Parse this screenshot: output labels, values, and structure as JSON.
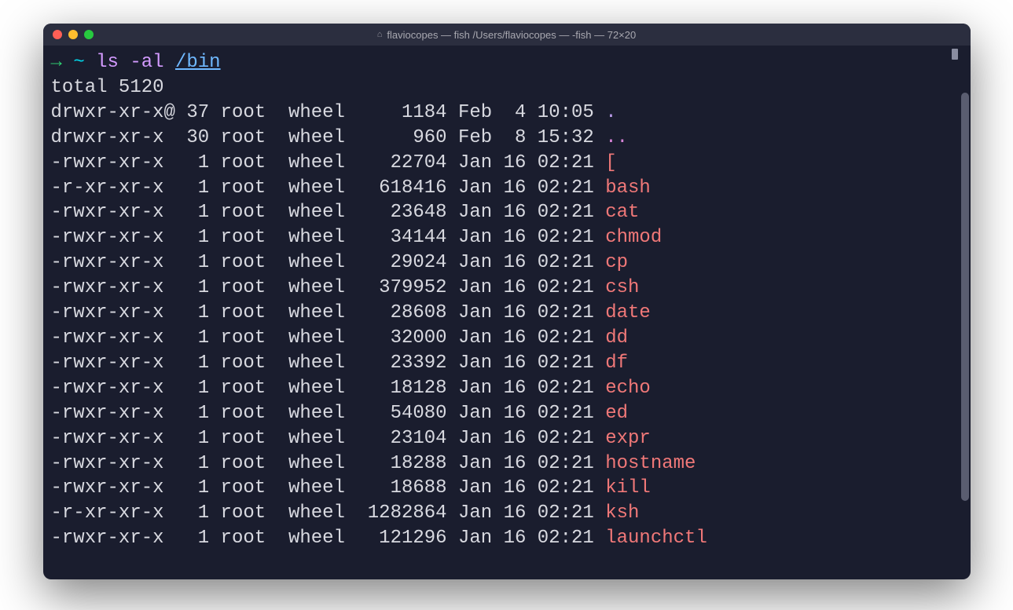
{
  "window": {
    "title": "flaviocopes — fish  /Users/flaviocopes — -fish — 72×20"
  },
  "prompt": {
    "arrow": "→",
    "tilde": "~",
    "cmd": "ls",
    "flags": "-al",
    "path": "/bin"
  },
  "total_line": "total 5120",
  "rows": [
    {
      "perms": "drwxr-xr-x@",
      "links": "37",
      "owner": "root",
      "group": "wheel",
      "size": "1184",
      "month": "Feb",
      "day": "4",
      "time": "10:05",
      "name": ".",
      "nameClass": "fname-dot"
    },
    {
      "perms": "drwxr-xr-x ",
      "links": "30",
      "owner": "root",
      "group": "wheel",
      "size": "960",
      "month": "Feb",
      "day": "8",
      "time": "15:32",
      "name": "..",
      "nameClass": "fname-ddot"
    },
    {
      "perms": "-rwxr-xr-x ",
      "links": "1",
      "owner": "root",
      "group": "wheel",
      "size": "22704",
      "month": "Jan",
      "day": "16",
      "time": "02:21",
      "name": "[",
      "nameClass": "fname-exec"
    },
    {
      "perms": "-r-xr-xr-x ",
      "links": "1",
      "owner": "root",
      "group": "wheel",
      "size": "618416",
      "month": "Jan",
      "day": "16",
      "time": "02:21",
      "name": "bash",
      "nameClass": "fname-exec"
    },
    {
      "perms": "-rwxr-xr-x ",
      "links": "1",
      "owner": "root",
      "group": "wheel",
      "size": "23648",
      "month": "Jan",
      "day": "16",
      "time": "02:21",
      "name": "cat",
      "nameClass": "fname-exec"
    },
    {
      "perms": "-rwxr-xr-x ",
      "links": "1",
      "owner": "root",
      "group": "wheel",
      "size": "34144",
      "month": "Jan",
      "day": "16",
      "time": "02:21",
      "name": "chmod",
      "nameClass": "fname-exec"
    },
    {
      "perms": "-rwxr-xr-x ",
      "links": "1",
      "owner": "root",
      "group": "wheel",
      "size": "29024",
      "month": "Jan",
      "day": "16",
      "time": "02:21",
      "name": "cp",
      "nameClass": "fname-exec"
    },
    {
      "perms": "-rwxr-xr-x ",
      "links": "1",
      "owner": "root",
      "group": "wheel",
      "size": "379952",
      "month": "Jan",
      "day": "16",
      "time": "02:21",
      "name": "csh",
      "nameClass": "fname-exec"
    },
    {
      "perms": "-rwxr-xr-x ",
      "links": "1",
      "owner": "root",
      "group": "wheel",
      "size": "28608",
      "month": "Jan",
      "day": "16",
      "time": "02:21",
      "name": "date",
      "nameClass": "fname-exec"
    },
    {
      "perms": "-rwxr-xr-x ",
      "links": "1",
      "owner": "root",
      "group": "wheel",
      "size": "32000",
      "month": "Jan",
      "day": "16",
      "time": "02:21",
      "name": "dd",
      "nameClass": "fname-exec"
    },
    {
      "perms": "-rwxr-xr-x ",
      "links": "1",
      "owner": "root",
      "group": "wheel",
      "size": "23392",
      "month": "Jan",
      "day": "16",
      "time": "02:21",
      "name": "df",
      "nameClass": "fname-exec"
    },
    {
      "perms": "-rwxr-xr-x ",
      "links": "1",
      "owner": "root",
      "group": "wheel",
      "size": "18128",
      "month": "Jan",
      "day": "16",
      "time": "02:21",
      "name": "echo",
      "nameClass": "fname-exec"
    },
    {
      "perms": "-rwxr-xr-x ",
      "links": "1",
      "owner": "root",
      "group": "wheel",
      "size": "54080",
      "month": "Jan",
      "day": "16",
      "time": "02:21",
      "name": "ed",
      "nameClass": "fname-exec"
    },
    {
      "perms": "-rwxr-xr-x ",
      "links": "1",
      "owner": "root",
      "group": "wheel",
      "size": "23104",
      "month": "Jan",
      "day": "16",
      "time": "02:21",
      "name": "expr",
      "nameClass": "fname-exec"
    },
    {
      "perms": "-rwxr-xr-x ",
      "links": "1",
      "owner": "root",
      "group": "wheel",
      "size": "18288",
      "month": "Jan",
      "day": "16",
      "time": "02:21",
      "name": "hostname",
      "nameClass": "fname-exec"
    },
    {
      "perms": "-rwxr-xr-x ",
      "links": "1",
      "owner": "root",
      "group": "wheel",
      "size": "18688",
      "month": "Jan",
      "day": "16",
      "time": "02:21",
      "name": "kill",
      "nameClass": "fname-exec"
    },
    {
      "perms": "-r-xr-xr-x ",
      "links": "1",
      "owner": "root",
      "group": "wheel",
      "size": "1282864",
      "month": "Jan",
      "day": "16",
      "time": "02:21",
      "name": "ksh",
      "nameClass": "fname-exec"
    },
    {
      "perms": "-rwxr-xr-x ",
      "links": "1",
      "owner": "root",
      "group": "wheel",
      "size": "121296",
      "month": "Jan",
      "day": "16",
      "time": "02:21",
      "name": "launchctl",
      "nameClass": "fname-exec"
    }
  ]
}
